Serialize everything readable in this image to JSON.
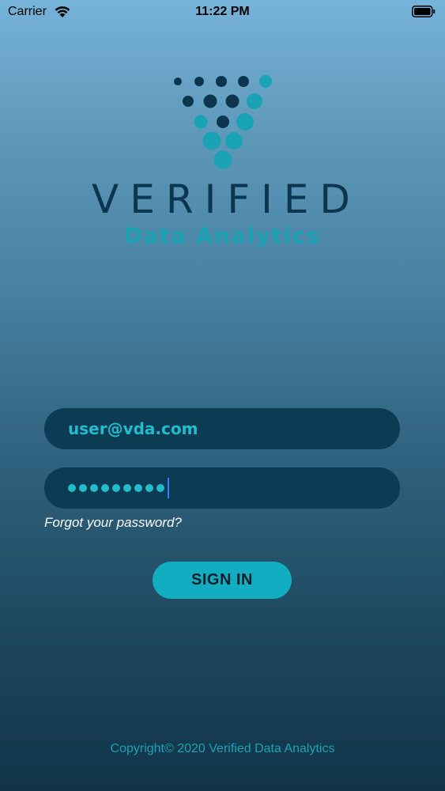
{
  "status_bar": {
    "carrier": "Carrier",
    "time": "11:22 PM",
    "wifi_icon": "wifi-icon",
    "battery_icon": "battery-icon"
  },
  "logo": {
    "brand_name": "VERIFIED",
    "brand_sub": "Data Analytics",
    "colors": {
      "dark": "#0c3550",
      "teal": "#1aa2b5"
    }
  },
  "login": {
    "email_value": "user@vda.com",
    "password_mask_count": 9,
    "forgot_label": "Forgot your password?",
    "signin_label": "SIGN IN"
  },
  "footer": {
    "copyright": "Copyright© 2020 Verified Data Analytics"
  },
  "colors": {
    "field_bg": "#0c3c54",
    "field_text": "#22bccd",
    "button_bg": "#12adc1",
    "cursor": "#3b7bff"
  }
}
